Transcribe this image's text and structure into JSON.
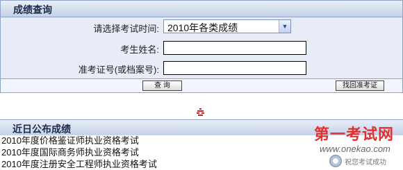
{
  "panel": {
    "title": "成绩查询"
  },
  "form": {
    "exam_time_label": "请选择考试时间:",
    "exam_time_value": "2010年各类成绩",
    "name_label": "考生姓名:",
    "name_value": "",
    "ticket_label": "准考证号(或档案号):",
    "ticket_value": "",
    "query_button": "查  询",
    "recover_button": "找回准考证"
  },
  "recent": {
    "title": "近日公布成绩",
    "items": [
      "2010年度价格鉴证师执业资格考试",
      "2010年度国际商务师执业资格考试",
      "2010年度注册安全工程师执业资格考试"
    ]
  },
  "watermark": {
    "title": "第一考试网",
    "url": "www.onekao.com",
    "slogan": "祝您考试成功"
  },
  "colors": {
    "accent": "#e13030",
    "header_bg": "#c5d1e8",
    "form_bg": "#e7ecf7",
    "border": "#8fa3c7"
  }
}
